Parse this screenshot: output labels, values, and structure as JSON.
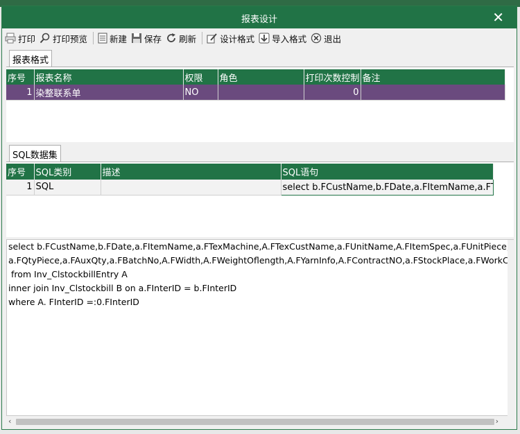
{
  "window": {
    "title": "报表设计",
    "close_glyph": "✕"
  },
  "toolbar": {
    "print": "打印",
    "print_preview": "打印预览",
    "new": "新建",
    "save": "保存",
    "refresh": "刷新",
    "design_format": "设计格式",
    "import_format": "导入格式",
    "exit": "退出"
  },
  "report_tab": {
    "label": "报表格式",
    "headers": [
      "序号",
      "报表名称",
      "权限",
      "角色",
      "打印次数控制",
      "备注"
    ],
    "rows": [
      {
        "seq": "1",
        "name": "染整联系单",
        "permission": "NO",
        "role": "",
        "print_count": "0",
        "remark": ""
      }
    ]
  },
  "sql_tab": {
    "label": "SQL数据集",
    "headers": [
      "序号",
      "SQL类别",
      "描述",
      "SQL语句"
    ],
    "rows": [
      {
        "seq": "1",
        "category": "SQL",
        "description": "",
        "statement": "select b.FCustName,b.FDate,a.FItemName,a.FTexM"
      }
    ]
  },
  "sql_text": [
    "select b.FCustName,b.FDate,a.FItemName,a.FTexMachine,A.FTexCustName,a.FUnitName,A.FItemSpec,a.FUnitPiece,",
    "a.FQtyPiece,a.FAuxQty,a.FBatchNo,A.FWidth,A.FWeightOflength,A.FYarnInfo,A.FContractNO,a.FStockPlace,a.FWorkC",
    " from Inv_ClstockbillEntry A",
    "inner join Inv_Clstockbill B on a.FInterID = b.FInterID",
    "where A. FInterID =:0.FInterID"
  ],
  "colors": {
    "accent": "#217346",
    "selected_row": "#6a4a7e"
  }
}
